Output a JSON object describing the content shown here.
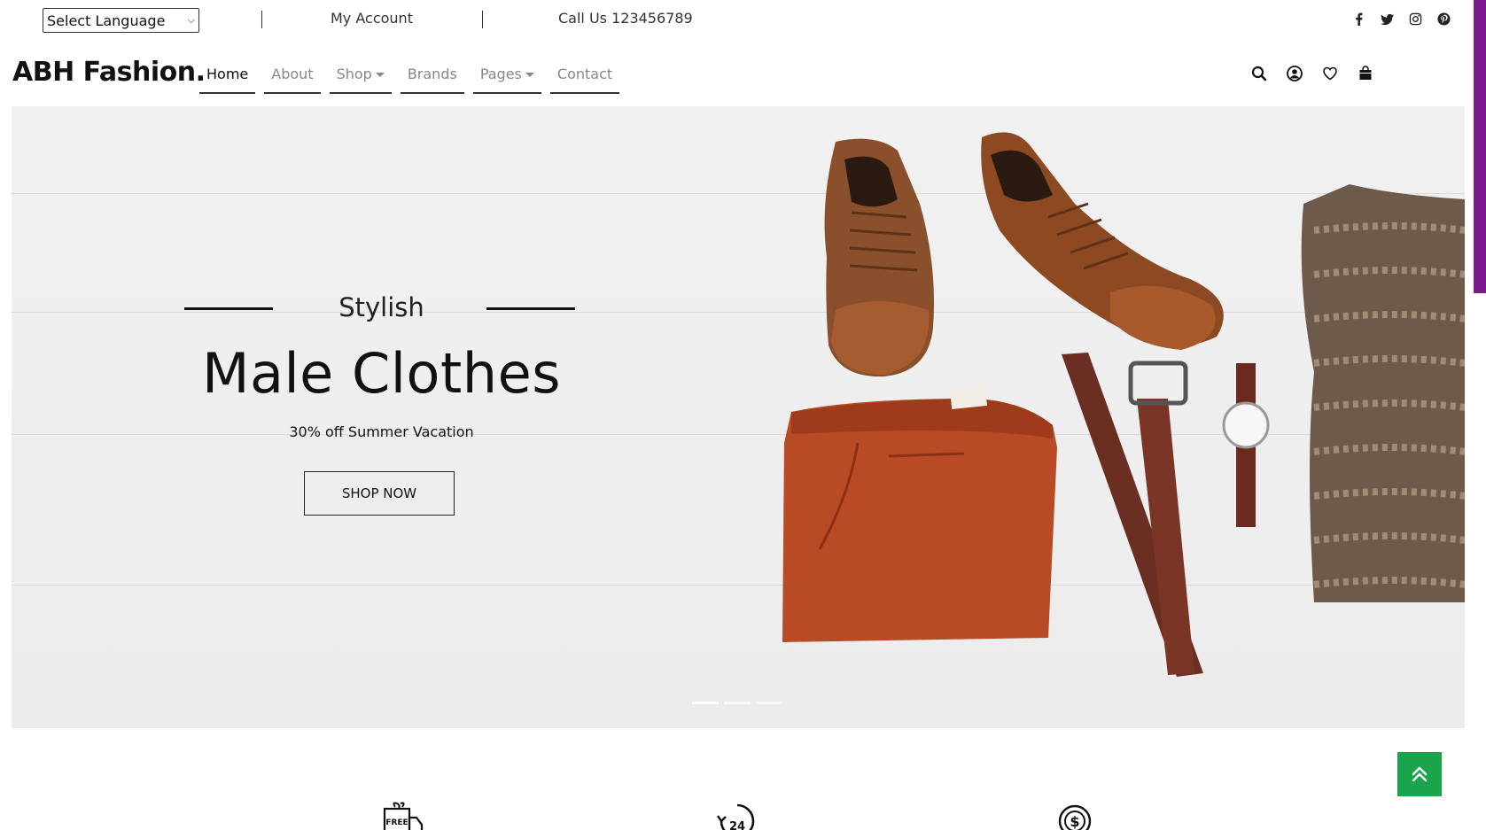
{
  "topbar": {
    "language_select": "Select Language",
    "my_account": "My Account",
    "call_us": "Call Us 123456789",
    "socials": [
      "facebook-icon",
      "twitter-icon",
      "instagram-icon",
      "pinterest-icon"
    ]
  },
  "header": {
    "brand": "ABH Fashion.",
    "nav": [
      {
        "label": "Home",
        "active": true
      },
      {
        "label": "About"
      },
      {
        "label": "Shop",
        "dropdown": true
      },
      {
        "label": "Brands"
      },
      {
        "label": "Pages",
        "dropdown": true
      },
      {
        "label": "Contact"
      }
    ],
    "icons": [
      "search-icon",
      "user-icon",
      "heart-icon",
      "bag-icon"
    ]
  },
  "hero": {
    "eyebrow": "Stylish",
    "headline": "Male Clothes",
    "subline": "30% off Summer Vacation",
    "cta": "SHOP NOW",
    "slides": 3,
    "active_slide": 1
  },
  "features": {
    "icons": [
      "free-delivery-icon",
      "24-hour-support-icon",
      "money-back-icon"
    ],
    "free_badge": "FREE",
    "support_badge": "24"
  },
  "colors": {
    "accent": "#7a1a8c",
    "to_top": "#1aa44b",
    "text": "#111111",
    "muted": "#888888"
  }
}
